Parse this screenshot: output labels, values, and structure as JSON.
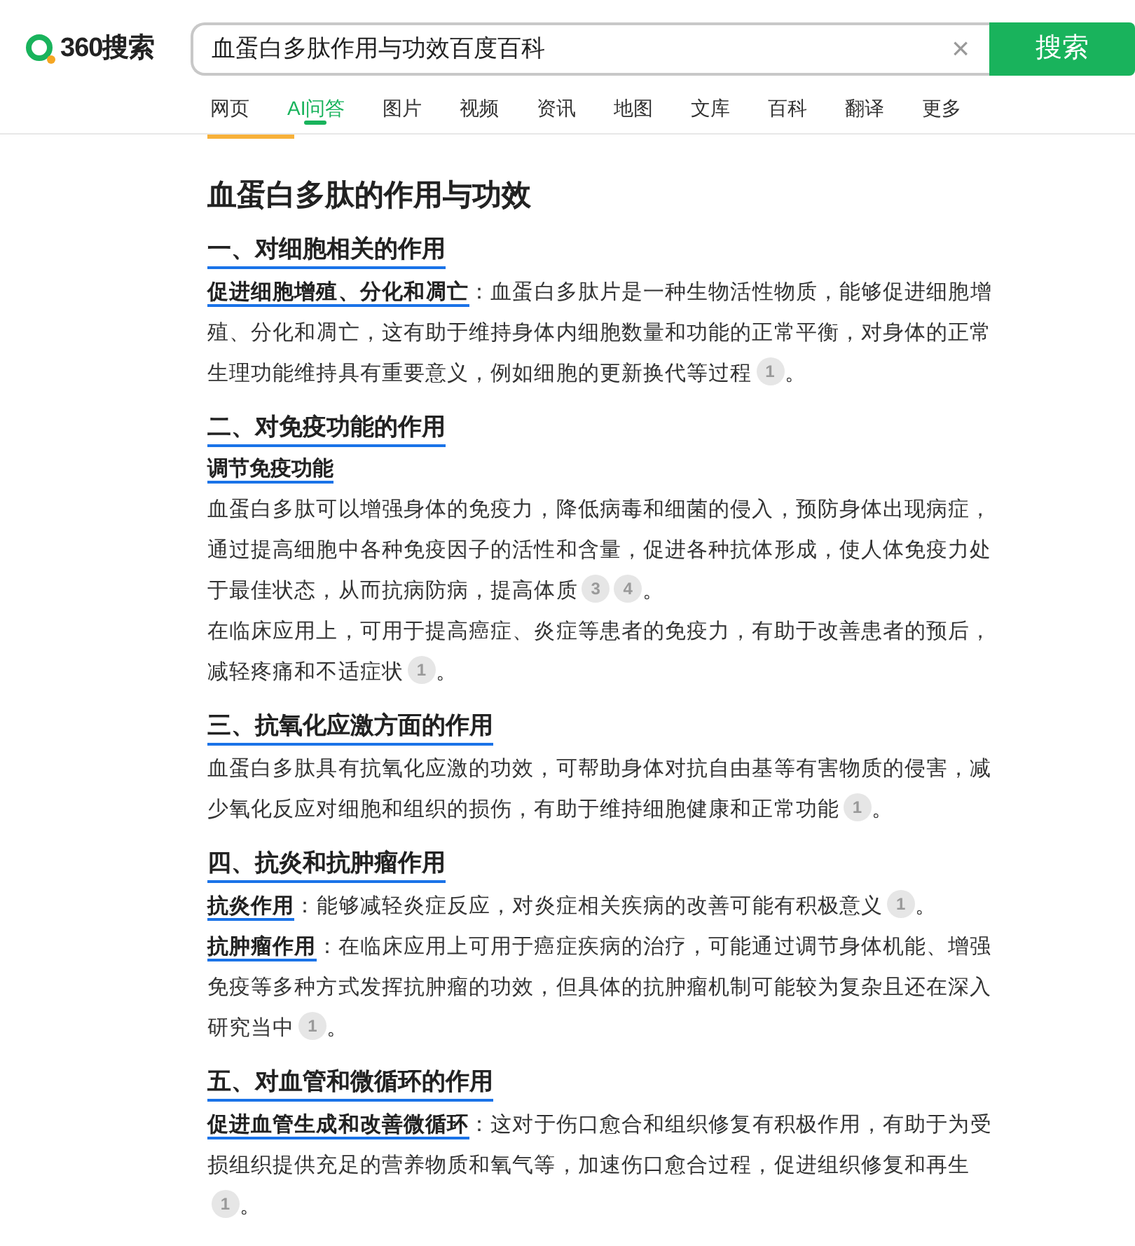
{
  "header": {
    "logo": "360搜索",
    "search": {
      "value": "血蛋白多肽作用与功效百度百科"
    },
    "clear": "×",
    "button": "搜索"
  },
  "tabs": [
    {
      "label": "网页",
      "selected": false
    },
    {
      "label": "AI问答",
      "selected": true
    },
    {
      "label": "图片",
      "selected": false
    },
    {
      "label": "视频",
      "selected": false
    },
    {
      "label": "资讯",
      "selected": false
    },
    {
      "label": "地图",
      "selected": false
    },
    {
      "label": "文库",
      "selected": false
    },
    {
      "label": "百科",
      "selected": false
    },
    {
      "label": "翻译",
      "selected": false
    },
    {
      "label": "更多",
      "selected": false
    }
  ],
  "article": {
    "title": "血蛋白多肽的作用与功效",
    "sections": [
      {
        "heading": "一、对细胞相关的作用",
        "blocks": [
          {
            "kind": "paragraph",
            "lead": "促进细胞增殖、分化和凋亡",
            "text": "：血蛋白多肽片是一种生物活性物质，能够促进细胞增殖、分化和凋亡，这有助于维持身体内细胞数量和功能的正常平衡，对身体的正常生理功能维持具有重要意义，例如细胞的更新换代等过程",
            "refs": [
              "1"
            ],
            "end": "。"
          }
        ]
      },
      {
        "heading": "二、对免疫功能的作用",
        "blocks": [
          {
            "kind": "subheading",
            "text": "调节免疫功能"
          },
          {
            "kind": "paragraph",
            "text": "血蛋白多肽可以增强身体的免疫力，降低病毒和细菌的侵入，预防身体出现病症，通过提高细胞中各种免疫因子的活性和含量，促进各种抗体形成，使人体免疫力处于最佳状态，从而抗病防病，提高体质",
            "refs": [
              "3",
              "4"
            ],
            "end": "。"
          },
          {
            "kind": "paragraph",
            "text": "在临床应用上，可用于提高癌症、炎症等患者的免疫力，有助于改善患者的预后，减轻疼痛和不适症状",
            "refs": [
              "1"
            ],
            "end": "。"
          }
        ]
      },
      {
        "heading": "三、抗氧化应激方面的作用",
        "blocks": [
          {
            "kind": "paragraph",
            "text": "血蛋白多肽具有抗氧化应激的功效，可帮助身体对抗自由基等有害物质的侵害，减少氧化反应对细胞和组织的损伤，有助于维持细胞健康和正常功能",
            "refs": [
              "1"
            ],
            "end": "。"
          }
        ]
      },
      {
        "heading": "四、抗炎和抗肿瘤作用",
        "blocks": [
          {
            "kind": "paragraph",
            "lead": "抗炎作用",
            "text": "：能够减轻炎症反应，对炎症相关疾病的改善可能有积极意义",
            "refs": [
              "1"
            ],
            "end": "。"
          },
          {
            "kind": "paragraph",
            "lead": "抗肿瘤作用",
            "text": "：在临床应用上可用于癌症疾病的治疗，可能通过调节身体机能、增强免疫等多种方式发挥抗肿瘤的功效，但具体的抗肿瘤机制可能较为复杂且还在深入研究当中",
            "refs": [
              "1"
            ],
            "end": "。"
          }
        ]
      },
      {
        "heading": "五、对血管和微循环的作用",
        "blocks": [
          {
            "kind": "paragraph",
            "lead": "促进血管生成和改善微循环",
            "text": "：这对于伤口愈合和组织修复有积极作用，有助于为受损组织提供充足的营养物质和氧气等，加速伤口愈合过程，促进组织修复和再生",
            "refs": [
              "1"
            ],
            "end": "。"
          }
        ]
      }
    ]
  }
}
